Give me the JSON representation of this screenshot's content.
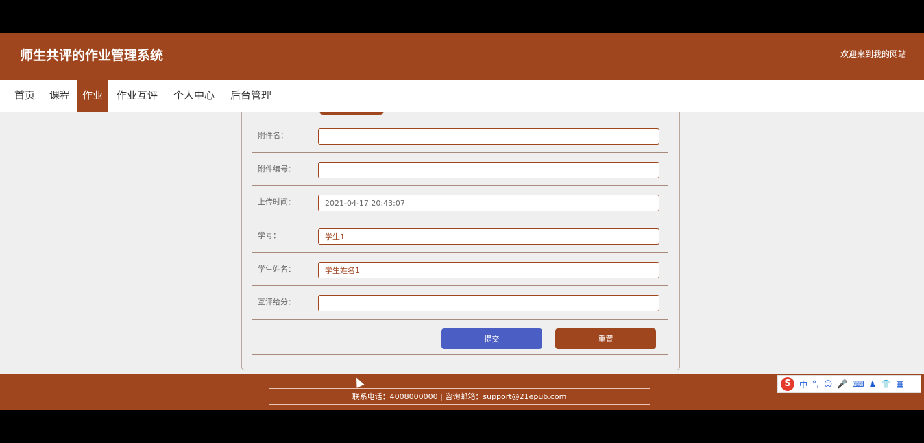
{
  "header": {
    "site_title": "师生共评的作业管理系统",
    "welcome": "欢迎来到我的网站"
  },
  "nav": {
    "items": [
      "首页",
      "课程",
      "作业",
      "作业互评",
      "个人中心",
      "后台管理"
    ],
    "active": "作业"
  },
  "form": {
    "fields": [
      {
        "label": "附件名：",
        "value": ""
      },
      {
        "label": "附件编号：",
        "value": ""
      },
      {
        "label": "上传时间：",
        "value": "2021-04-17 20:43:07"
      },
      {
        "label": "学号：",
        "value": "学生1"
      },
      {
        "label": "学生姓名：",
        "value": "学生姓名1"
      },
      {
        "label": "互评给分：",
        "value": ""
      }
    ],
    "submit_label": "提交",
    "reset_label": "重置"
  },
  "footer": {
    "contact": "联系电话：4008000000 | 咨询邮箱：support@21epub.com"
  },
  "ime": {
    "logo": "S",
    "items": [
      "中",
      "°,",
      "☺",
      "🎤",
      "⌨",
      "♟",
      "👕",
      "▦"
    ]
  },
  "colors": {
    "brand": "#a0461f",
    "submit": "#4b5ec4"
  }
}
